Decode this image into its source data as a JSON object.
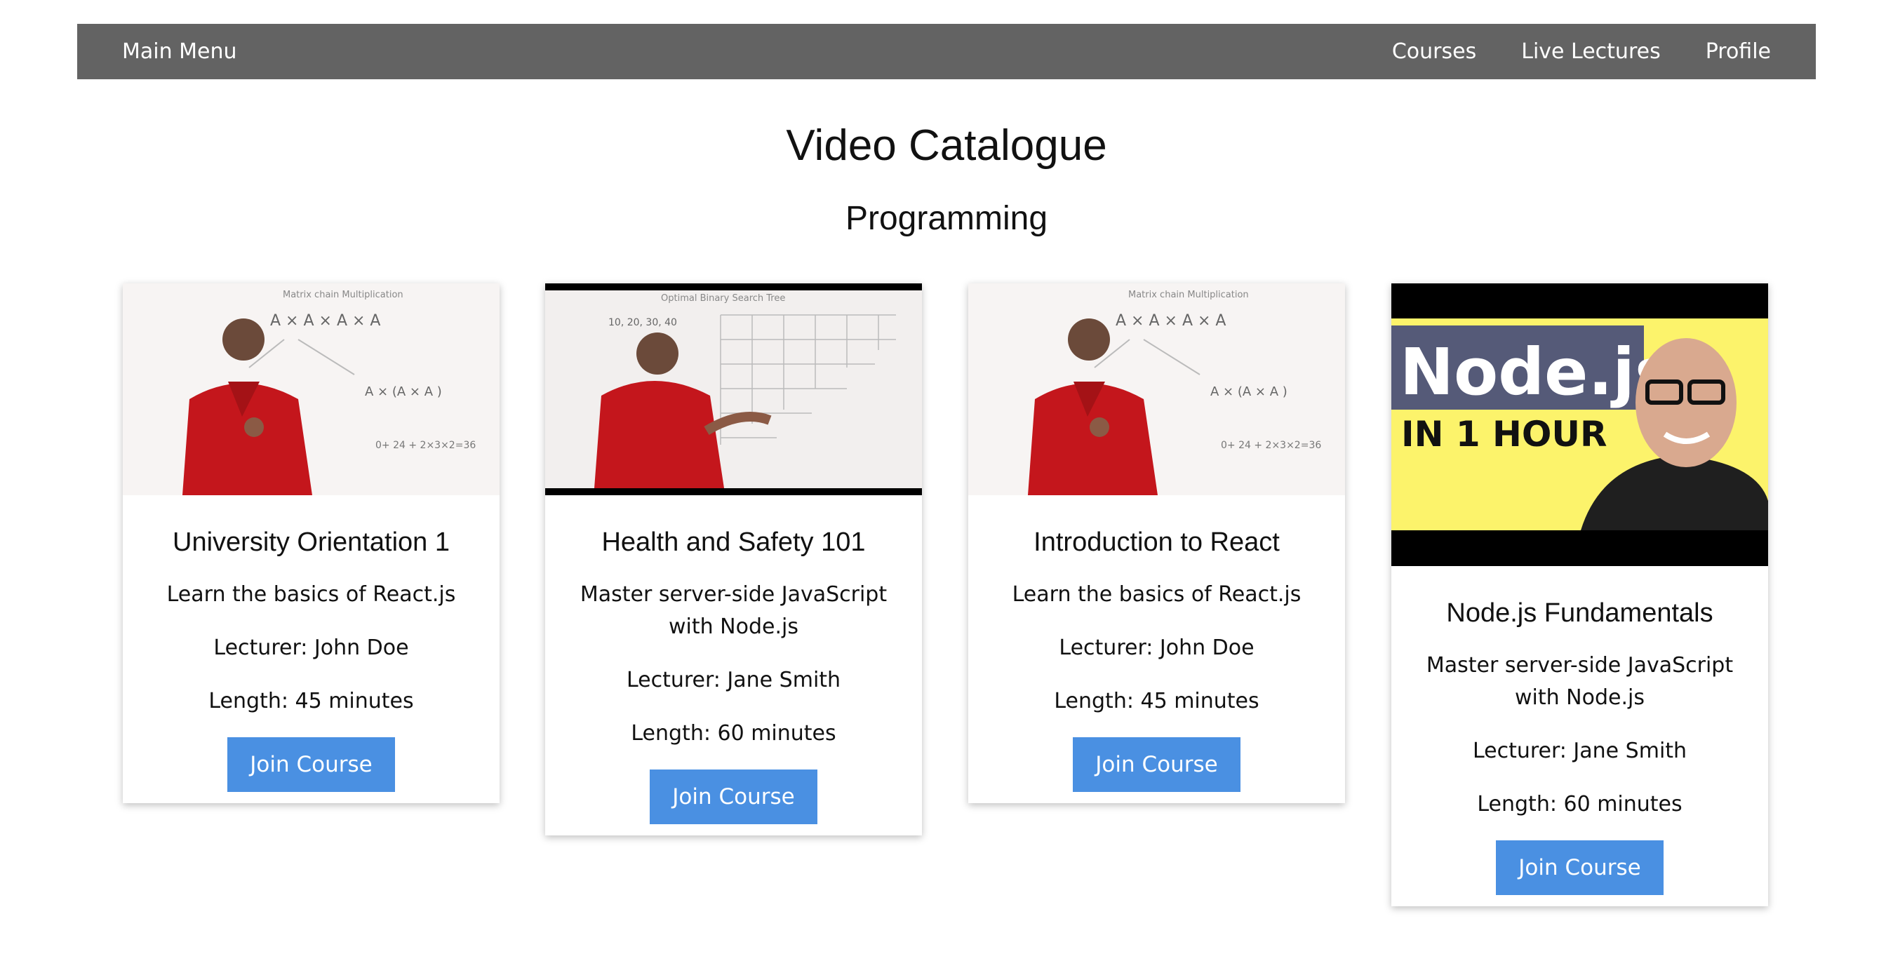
{
  "nav": {
    "main_menu": "Main Menu",
    "courses": "Courses",
    "live_lectures": "Live Lectures",
    "profile": "Profile"
  },
  "page": {
    "title": "Video Catalogue",
    "section": "Programming"
  },
  "cards": [
    {
      "title": "University Orientation 1",
      "description": "Learn the basics of React.js",
      "lecturer": "Lecturer: John Doe",
      "length": "Length: 45 minutes",
      "button": "Join Course",
      "thumbnail": "lecturer-whiteboard-matrix-chain"
    },
    {
      "title": "Health and Safety 101",
      "description": "Master server-side JavaScript with Node.js",
      "lecturer": "Lecturer: Jane Smith",
      "length": "Length: 60 minutes",
      "button": "Join Course",
      "thumbnail": "lecturer-whiteboard-bst-table"
    },
    {
      "title": "Introduction to React",
      "description": "Learn the basics of React.js",
      "lecturer": "Lecturer: John Doe",
      "length": "Length: 45 minutes",
      "button": "Join Course",
      "thumbnail": "lecturer-whiteboard-matrix-chain"
    },
    {
      "title": "Node.js Fundamentals",
      "description": "Master server-side JavaScript with Node.js",
      "lecturer": "Lecturer: Jane Smith",
      "length": "Length: 60 minutes",
      "button": "Join Course",
      "thumbnail": "nodejs-in-1-hour-banner",
      "thumb_text_1": "Node.js",
      "thumb_text_2": "IN 1 HOUR"
    }
  ],
  "colors": {
    "navbar": "#636363",
    "button": "#4a90e2",
    "node_banner_yellow": "#fcf36b",
    "node_banner_label": "#555a78"
  }
}
